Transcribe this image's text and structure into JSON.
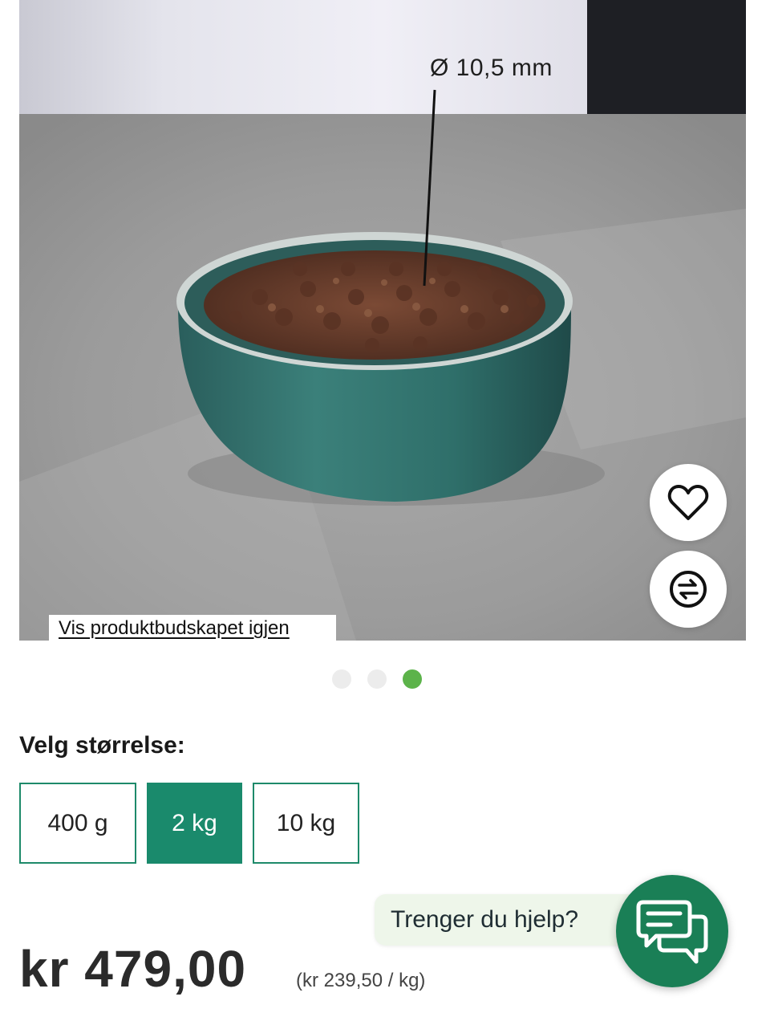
{
  "product_image": {
    "dimension_label": "Ø 10,5 mm",
    "revisit_link": "Vis produktbudskapet igjen",
    "slide_count": 3,
    "active_slide": 3
  },
  "actions": {
    "favorite_icon": "heart-icon",
    "compare_icon": "compare-arrows-icon"
  },
  "size_selector": {
    "label": "Velg størrelse:",
    "options": [
      "400 g",
      "2 kg",
      "10 kg"
    ],
    "selected": "2 kg"
  },
  "help": {
    "text": "Trenger du hjelp?",
    "icon": "chat-bubbles-icon"
  },
  "pricing": {
    "price": "kr 479,00",
    "unit_price": "(kr 239,50 / kg)"
  },
  "colors": {
    "accent_green": "#1a8a6c",
    "dot_active": "#5cb34a",
    "chat_button": "#1a7f56",
    "help_bubble": "#eef6ea"
  }
}
